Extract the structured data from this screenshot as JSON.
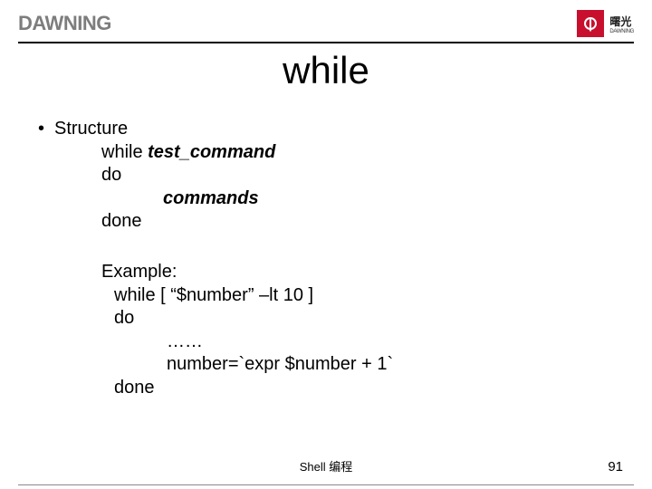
{
  "header": {
    "brand_left": "DAWNING",
    "brand_cn": "曙光",
    "brand_en": "DAWNING"
  },
  "title": "while",
  "content": {
    "bullet1": "Structure",
    "l1": "while ",
    "l1_it": "test_command",
    "l2": "do",
    "l3_it": "commands",
    "l4": "done",
    "ex_label": "Example:",
    "ex1": "while [ “$number” –lt 10 ]",
    "ex2": "do",
    "ex3": "……",
    "ex4": "number=`expr $number + 1`",
    "ex5": "done"
  },
  "footer": {
    "center": "Shell 编程",
    "page": "91"
  }
}
